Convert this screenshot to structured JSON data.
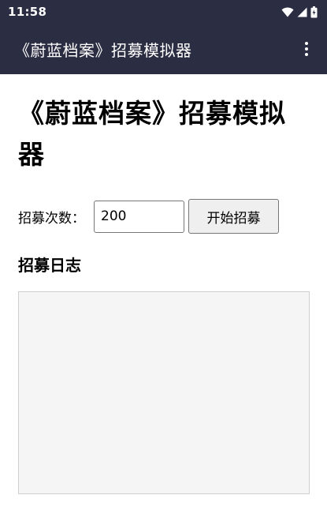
{
  "status_bar": {
    "time": "11:58",
    "icons": [
      "wifi-icon",
      "cell-signal-icon",
      "battery-icon"
    ]
  },
  "app_bar": {
    "title": "《蔚蓝档案》招募模拟器",
    "menu_icon": "overflow-menu-icon"
  },
  "main": {
    "page_title": "《蔚蓝档案》招募模拟器",
    "count_label": "招募次数：",
    "count_value": "200",
    "start_button_label": "开始招募",
    "log_heading": "招募日志",
    "log_text": ""
  },
  "colors": {
    "app_bar_bg": "#2b2d42",
    "button_bg": "#efefef",
    "log_bg": "#f5f5f5"
  }
}
